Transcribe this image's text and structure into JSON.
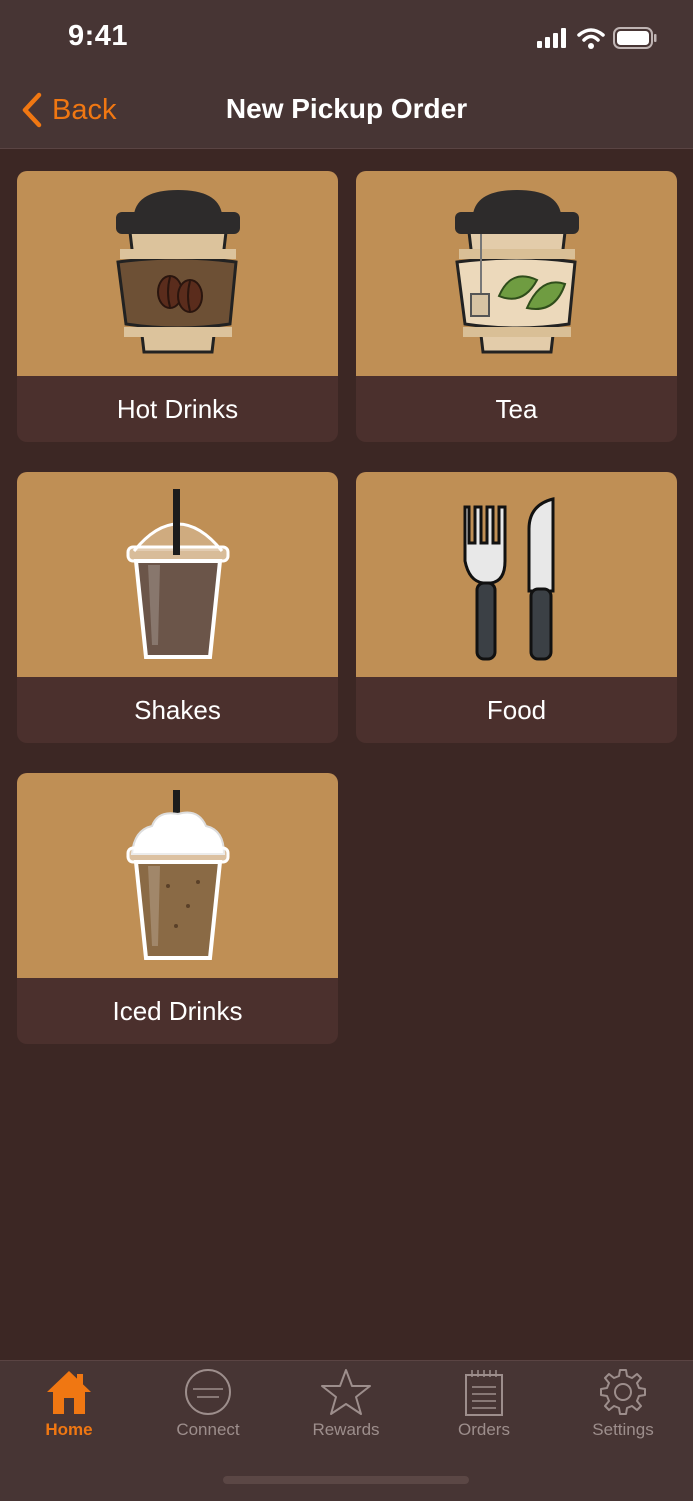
{
  "status_bar": {
    "time": "9:41"
  },
  "nav": {
    "back_label": "Back",
    "title": "New Pickup Order"
  },
  "categories": [
    {
      "label": "Hot Drinks",
      "icon": "coffee-cup-icon"
    },
    {
      "label": "Tea",
      "icon": "tea-cup-icon"
    },
    {
      "label": "Shakes",
      "icon": "shake-cup-icon"
    },
    {
      "label": "Food",
      "icon": "fork-knife-icon"
    },
    {
      "label": "Iced Drinks",
      "icon": "iced-drink-icon"
    }
  ],
  "tabs": [
    {
      "label": "Home",
      "icon": "home-icon",
      "active": true
    },
    {
      "label": "Connect",
      "icon": "connect-logo-icon",
      "active": false
    },
    {
      "label": "Rewards",
      "icon": "star-icon",
      "active": false
    },
    {
      "label": "Orders",
      "icon": "notepad-icon",
      "active": false
    },
    {
      "label": "Settings",
      "icon": "gear-icon",
      "active": false
    }
  ],
  "colors": {
    "accent": "#f07712",
    "background": "#3c2724",
    "bar": "#473534",
    "tile": "#bf8f55",
    "caption": "#4b302d"
  }
}
